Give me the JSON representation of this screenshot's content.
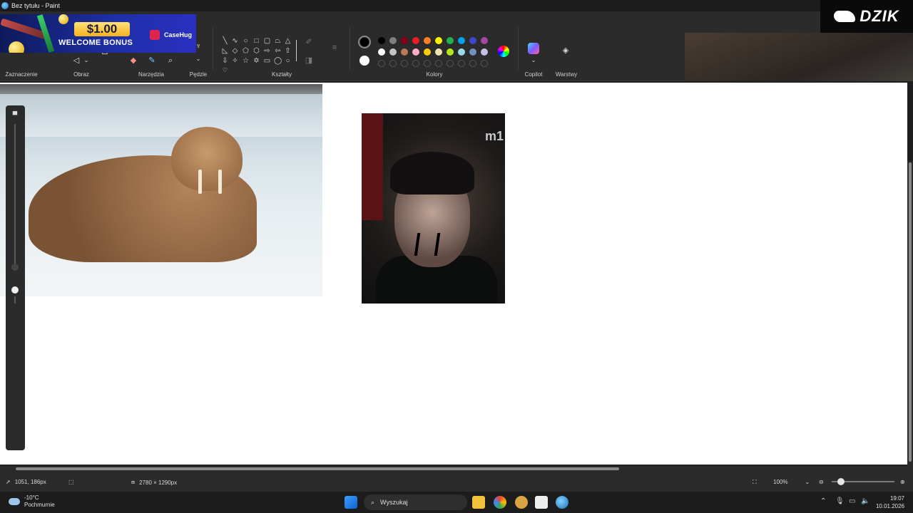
{
  "window": {
    "title": "Bez tytułu - Paint"
  },
  "ribbon": {
    "groups": {
      "selection": "Zaznaczenie",
      "image": "Obraz",
      "tools": "Narzędzia",
      "brushes": "Pędzle",
      "shapes": "Kształty",
      "colors": "Kolory",
      "copilot": "Copilot",
      "layers": "Warstwy"
    },
    "color_rows": [
      [
        "#000000",
        "#7f7f7f",
        "#880015",
        "#ed1c24",
        "#ff7f27",
        "#fff200",
        "#22b14c",
        "#00a2e8",
        "#3f48cc",
        "#a349a4"
      ],
      [
        "#ffffff",
        "#c3c3c3",
        "#b97a57",
        "#ffaec9",
        "#ffc90e",
        "#efe4b0",
        "#b5e61d",
        "#99d9ea",
        "#7092be",
        "#c8bfe7"
      ]
    ],
    "primary_color": "#000000",
    "secondary_color": "#ffffff"
  },
  "ad": {
    "amount": "$1.00",
    "text": "WELCOME BONUS",
    "brand": "CaseHug"
  },
  "logo": {
    "text": "DZIK"
  },
  "canvas": {
    "photo_caption": "m1"
  },
  "status": {
    "cursor_pos": "1051, 186px",
    "canvas_size": "2780 × 1290px",
    "zoom": "100%",
    "zoom_fraction": 0.1
  },
  "taskbar": {
    "weather_temp": "-10°C",
    "weather_desc": "Pochmurnie",
    "search_placeholder": "Wyszukaj",
    "time": "19:07",
    "date": "10.01.2026"
  }
}
